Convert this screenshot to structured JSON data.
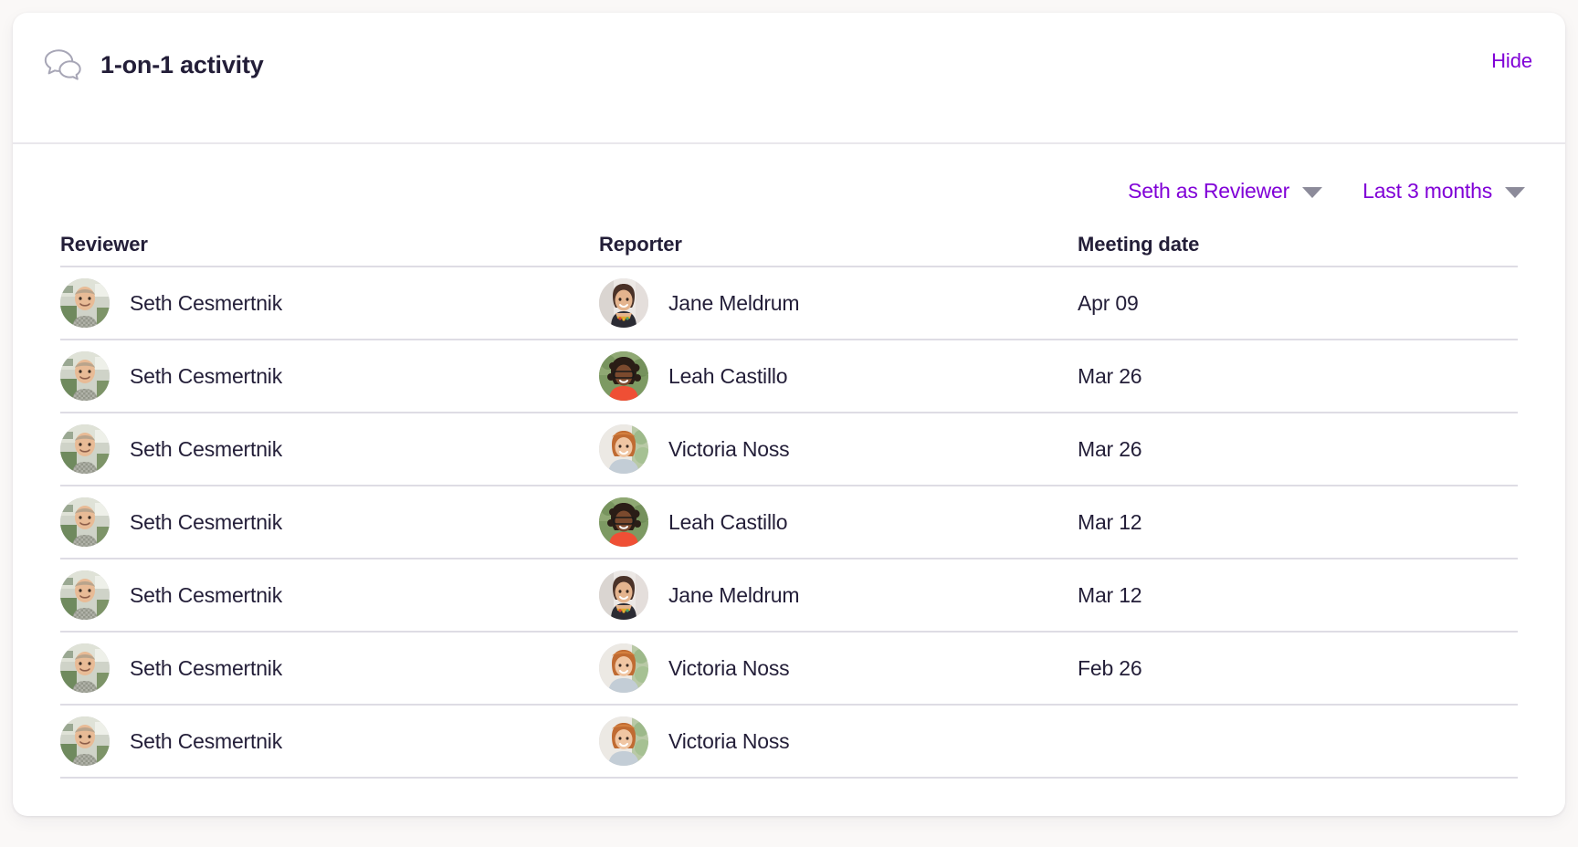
{
  "theme": {
    "page_background": "#FAF8F7",
    "card_background": "#FFFFFF",
    "accent_purple": "#8000D7",
    "text_dark": "#231E38",
    "divider": "#DEDCE4",
    "caret_gray": "#8C8B9A"
  },
  "header": {
    "icon": "chat-bubbles-icon",
    "title": "1-on-1 activity",
    "hide_label": "Hide"
  },
  "filters": [
    {
      "label": "Seth as Reviewer",
      "icon": "chevron-down-icon"
    },
    {
      "label": "Last 3 months",
      "icon": "chevron-down-icon"
    }
  ],
  "table": {
    "columns": [
      "Reviewer",
      "Reporter",
      "Meeting date"
    ],
    "rows": [
      {
        "reviewer": "Seth Cesmertnik",
        "reviewer_avatar": "seth-avatar",
        "reporter": "Jane Meldrum",
        "reporter_avatar": "jane-avatar",
        "date": "Apr 09"
      },
      {
        "reviewer": "Seth Cesmertnik",
        "reviewer_avatar": "seth-avatar",
        "reporter": "Leah Castillo",
        "reporter_avatar": "leah-avatar",
        "date": "Mar 26"
      },
      {
        "reviewer": "Seth Cesmertnik",
        "reviewer_avatar": "seth-avatar",
        "reporter": "Victoria Noss",
        "reporter_avatar": "victoria-avatar",
        "date": "Mar 26"
      },
      {
        "reviewer": "Seth Cesmertnik",
        "reviewer_avatar": "seth-avatar",
        "reporter": "Leah Castillo",
        "reporter_avatar": "leah-avatar",
        "date": "Mar 12"
      },
      {
        "reviewer": "Seth Cesmertnik",
        "reviewer_avatar": "seth-avatar",
        "reporter": "Jane Meldrum",
        "reporter_avatar": "jane-avatar",
        "date": "Mar 12"
      },
      {
        "reviewer": "Seth Cesmertnik",
        "reviewer_avatar": "seth-avatar",
        "reporter": "Victoria Noss",
        "reporter_avatar": "victoria-avatar",
        "date": "Feb 26"
      },
      {
        "reviewer": "Seth Cesmertnik",
        "reviewer_avatar": "seth-avatar",
        "reporter": "Victoria Noss",
        "reporter_avatar": "victoria-avatar",
        "date": ""
      }
    ]
  }
}
